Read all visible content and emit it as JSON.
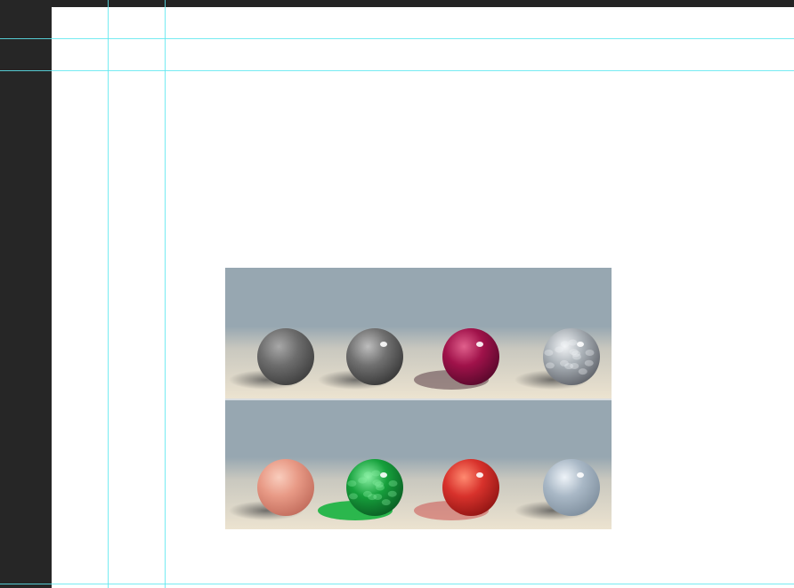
{
  "canvas": {
    "pasteboard_color": "#242424",
    "document_color": "#ffffff",
    "guide_color": "#5ee8f0"
  },
  "guides": {
    "vertical_count": 2,
    "horizontal_count": 3
  },
  "placed_image": {
    "rows": [
      {
        "spheres": [
          {
            "material": "matte-gray",
            "base": "#6d6d6d",
            "light": "#a8a8a8",
            "dark": "#3c3c3c"
          },
          {
            "material": "glossy-gray",
            "base": "#707070",
            "light": "#bdbdbd",
            "dark": "#353535"
          },
          {
            "material": "glossy-magenta",
            "base": "#a0124a",
            "light": "#e0608c",
            "dark": "#55082a"
          },
          {
            "material": "hammered-metal",
            "base": "#a9b0b6",
            "light": "#f2f4f6",
            "dark": "#5c5f66"
          }
        ]
      },
      {
        "spheres": [
          {
            "material": "skin-pink",
            "base": "#e89a86",
            "light": "#f9cdbd",
            "dark": "#c06a5a"
          },
          {
            "material": "green-glass",
            "base": "#16a03c",
            "light": "#8af0a4",
            "dark": "#0a5a22"
          },
          {
            "material": "red-subsurface",
            "base": "#d8322c",
            "light": "#ff8a70",
            "dark": "#8e1412"
          },
          {
            "material": "clear-glass",
            "base": "#a9b8c6",
            "light": "#eef3f8",
            "dark": "#7d8d9c"
          }
        ]
      }
    ],
    "background": {
      "sky": "#97a7b1",
      "floor": "#ece3d0"
    }
  }
}
